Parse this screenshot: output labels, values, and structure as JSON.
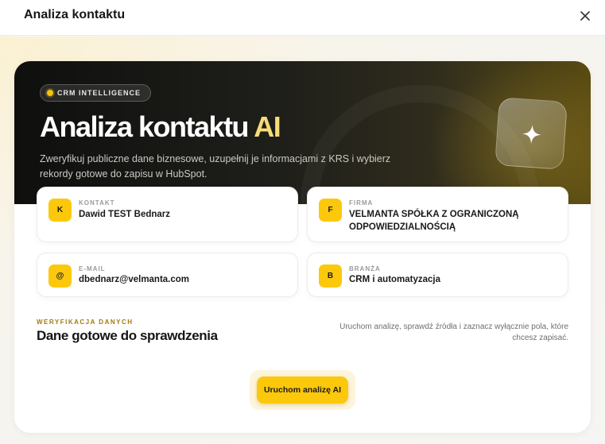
{
  "modal": {
    "title": "Analiza kontaktu"
  },
  "hero": {
    "pill_label": "CRM INTELLIGENCE",
    "title_main": "Analiza kontaktu",
    "title_accent": "AI",
    "description": "Zweryfikuj publiczne dane biznesowe, uzupełnij je informacjami z KRS i wybierz rekordy gotowe do zapisu w HubSpot."
  },
  "fields": {
    "contact": {
      "badge": "K",
      "label": "KONTAKT",
      "value": "Dawid TEST Bednarz"
    },
    "company": {
      "badge": "F",
      "label": "FIRMA",
      "value": "VELMANTA SPÓŁKA Z OGRANICZONĄ ODPOWIEDZIALNOŚCIĄ"
    },
    "email": {
      "badge": "@",
      "label": "E-MAIL",
      "value": "dbednarz@velmanta.com"
    },
    "industry": {
      "badge": "B",
      "label": "BRANŻA",
      "value": "CRM i automatyzacja"
    }
  },
  "verification": {
    "label": "WERYFIKACJA DANYCH",
    "title": "Dane gotowe do sprawdzenia",
    "description": "Uruchom analizę, sprawdź źródła i zaznacz wyłącznie pola, które chcesz zapisać."
  },
  "actions": {
    "run_label": "Uruchom analizę AI"
  },
  "colors": {
    "accent": "#fcc80b",
    "hero_dark": "#0f0f0e",
    "accent_text": "#f7dc78"
  }
}
